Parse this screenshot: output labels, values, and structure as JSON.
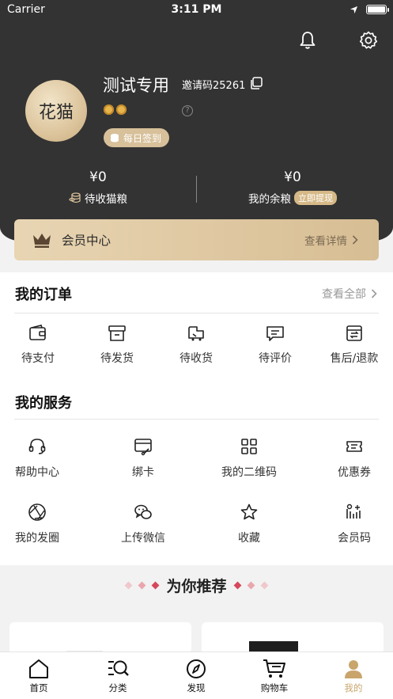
{
  "status_bar": {
    "carrier": "Carrier",
    "time": "3:11 PM"
  },
  "profile": {
    "avatar_text": "花猫",
    "username": "测试专用",
    "invite_code": "邀请码25261",
    "help_mark": "?",
    "signin_label": "每日签到"
  },
  "stats": {
    "pending": {
      "value": "¥0",
      "label": "待收猫粮"
    },
    "balance": {
      "value": "¥0",
      "label": "我的余粮",
      "action": "立即提现"
    }
  },
  "vip": {
    "title": "会员中心",
    "more": "查看详情"
  },
  "orders": {
    "title": "我的订单",
    "see_all": "查看全部",
    "items": [
      {
        "label": "待支付",
        "icon": "wallet-icon"
      },
      {
        "label": "待发货",
        "icon": "box-icon"
      },
      {
        "label": "待收货",
        "icon": "delivery-icon"
      },
      {
        "label": "待评价",
        "icon": "comment-icon"
      },
      {
        "label": "售后/退款",
        "icon": "refund-icon"
      }
    ]
  },
  "services": {
    "title": "我的服务",
    "items": [
      {
        "label": "帮助中心",
        "icon": "headset-icon"
      },
      {
        "label": "绑卡",
        "icon": "card-icon"
      },
      {
        "label": "我的二维码",
        "icon": "qrcode-icon"
      },
      {
        "label": "优惠券",
        "icon": "coupon-icon"
      },
      {
        "label": "我的发圈",
        "icon": "aperture-icon"
      },
      {
        "label": "上传微信",
        "icon": "wechat-icon"
      },
      {
        "label": "收藏",
        "icon": "star-icon"
      },
      {
        "label": "会员码",
        "icon": "member-code-icon"
      }
    ]
  },
  "recommend": {
    "title": "为你推荐"
  },
  "tabbar": {
    "items": [
      {
        "label": "首页",
        "icon": "home-icon"
      },
      {
        "label": "分类",
        "icon": "category-search-icon"
      },
      {
        "label": "发现",
        "icon": "compass-icon"
      },
      {
        "label": "购物车",
        "icon": "cart-icon"
      },
      {
        "label": "我的",
        "icon": "profile-icon",
        "active": true
      }
    ]
  },
  "colors": {
    "header_bg": "#333333",
    "gold": "#d7c09a",
    "active_tab": "#c9a56c"
  }
}
